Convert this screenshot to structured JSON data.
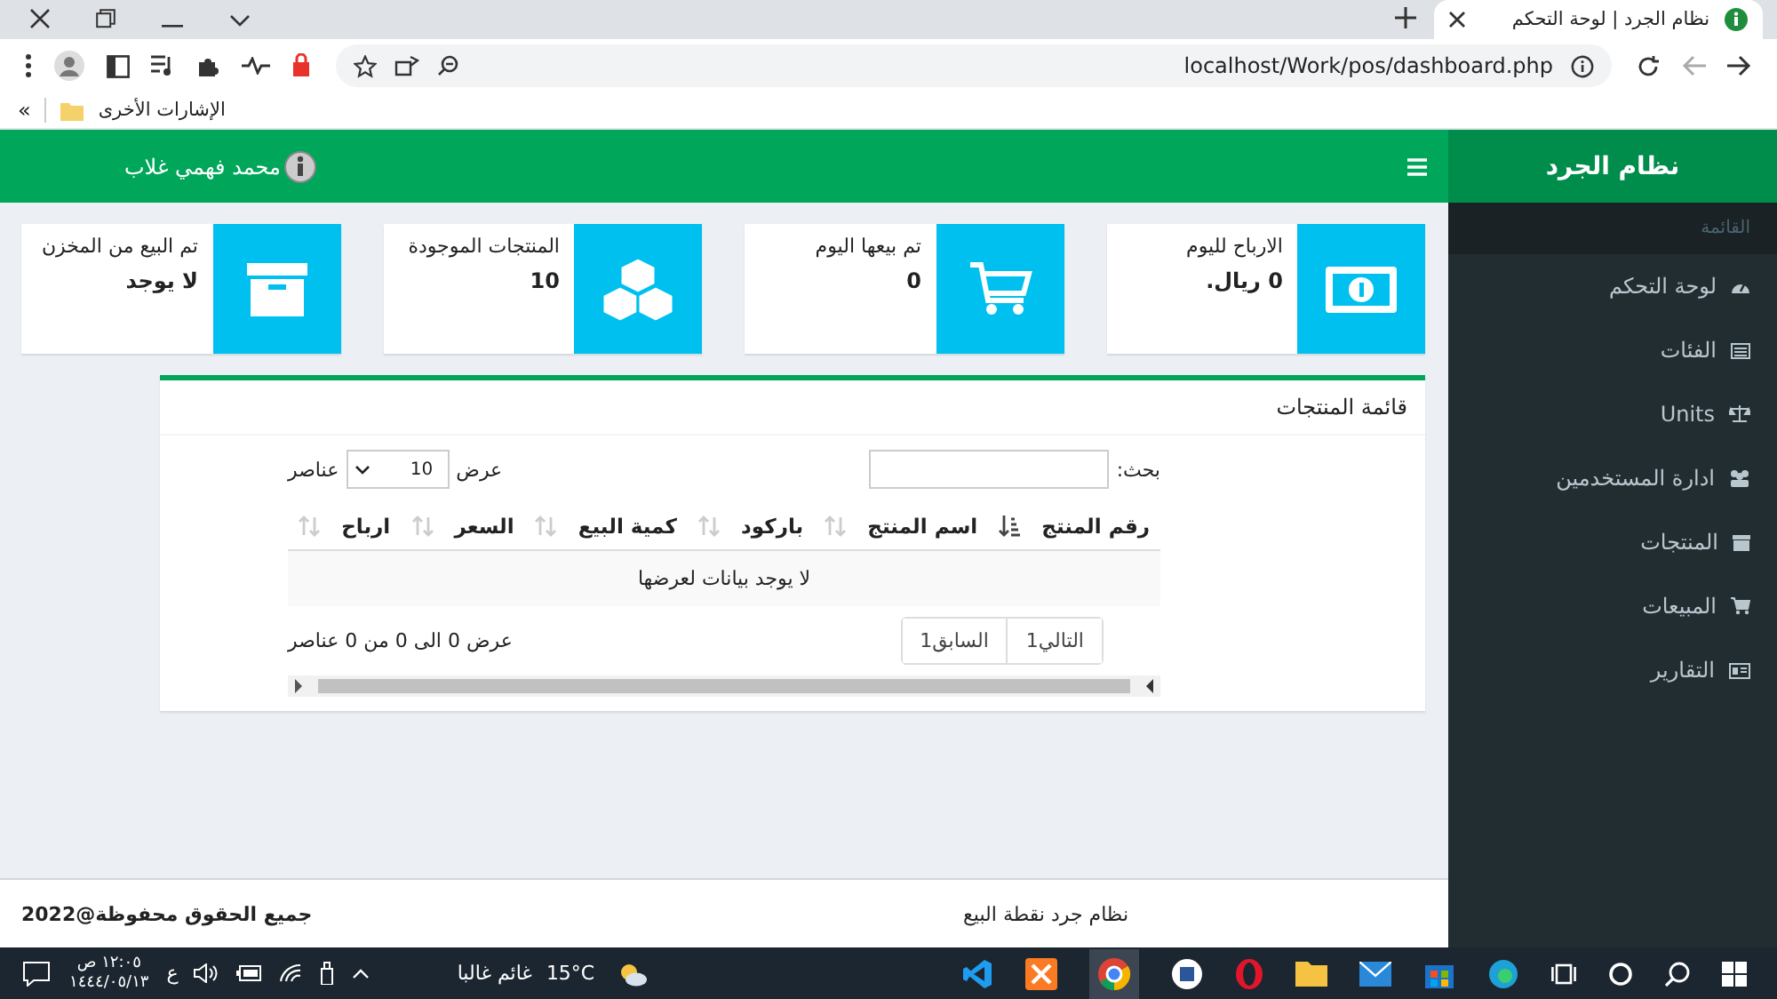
{
  "browser": {
    "tab": {
      "title": "نظام الجرد | لوحة التحكم",
      "selected": true
    },
    "url": "localhost/Work/pos/dashboard.php",
    "bookmarks": {
      "overflow": "»",
      "folder": "الإشارات الأخرى"
    }
  },
  "header": {
    "app_name": "نظام الجرد",
    "user": "محمد فهمي غلاب"
  },
  "sidebar": {
    "heading": "القائمة",
    "items": [
      {
        "label": "لوحة التحكم",
        "kind": "dashboard",
        "selected": false
      },
      {
        "label": "الفئات",
        "kind": "list",
        "selected": false
      },
      {
        "label": "Units",
        "kind": "scale",
        "selected": false
      },
      {
        "label": "ادارة المستخدمين",
        "kind": "users",
        "selected": false
      },
      {
        "label": "المنتجات",
        "kind": "box",
        "selected": false
      },
      {
        "label": "المبيعات",
        "kind": "cart",
        "selected": false
      },
      {
        "label": "التقارير",
        "kind": "card",
        "selected": false
      }
    ]
  },
  "info_boxes": [
    {
      "label": "الارباح لليوم",
      "value": "0 ريال.",
      "kind": "money"
    },
    {
      "label": "تم بيعها اليوم",
      "value": "0",
      "kind": "cart"
    },
    {
      "label": "المنتجات الموجودة",
      "value": "10",
      "kind": "cubes"
    },
    {
      "label": "تم البيع من المخزن",
      "value": "لا يوجد",
      "kind": "archive"
    }
  ],
  "products_panel": {
    "title": "قائمة المنتجات",
    "search_label": "بحث:",
    "length": {
      "prefix": "عرض",
      "value": "10",
      "suffix": "عناصر"
    },
    "table": {
      "columns": [
        {
          "label": "رقم المنتج",
          "sorted": true
        },
        {
          "label": "اسم المنتج",
          "sorted": false
        },
        {
          "label": "باركود",
          "sorted": false
        },
        {
          "label": "كمية البيع",
          "sorted": false
        },
        {
          "label": "السعر",
          "sorted": false
        },
        {
          "label": "ارباح",
          "sorted": false
        }
      ],
      "empty_message": "لا يوجد بيانات لعرضها"
    },
    "info": "عرض 0 الى 0 من 0 عناصر",
    "pagination": [
      "التالي1",
      "السابق1"
    ]
  },
  "footer": {
    "app": "نظام جرد نقطة البيع",
    "copyright": "جميع الحقوق محفوظة@2022"
  },
  "taskbar": {
    "weather": {
      "temperature": "15°C",
      "condition": "غائم غالبا"
    },
    "language": "ع",
    "time": "١٢:٠٥ ص",
    "date": "١٤٤٤/٠٥/١٣"
  }
}
